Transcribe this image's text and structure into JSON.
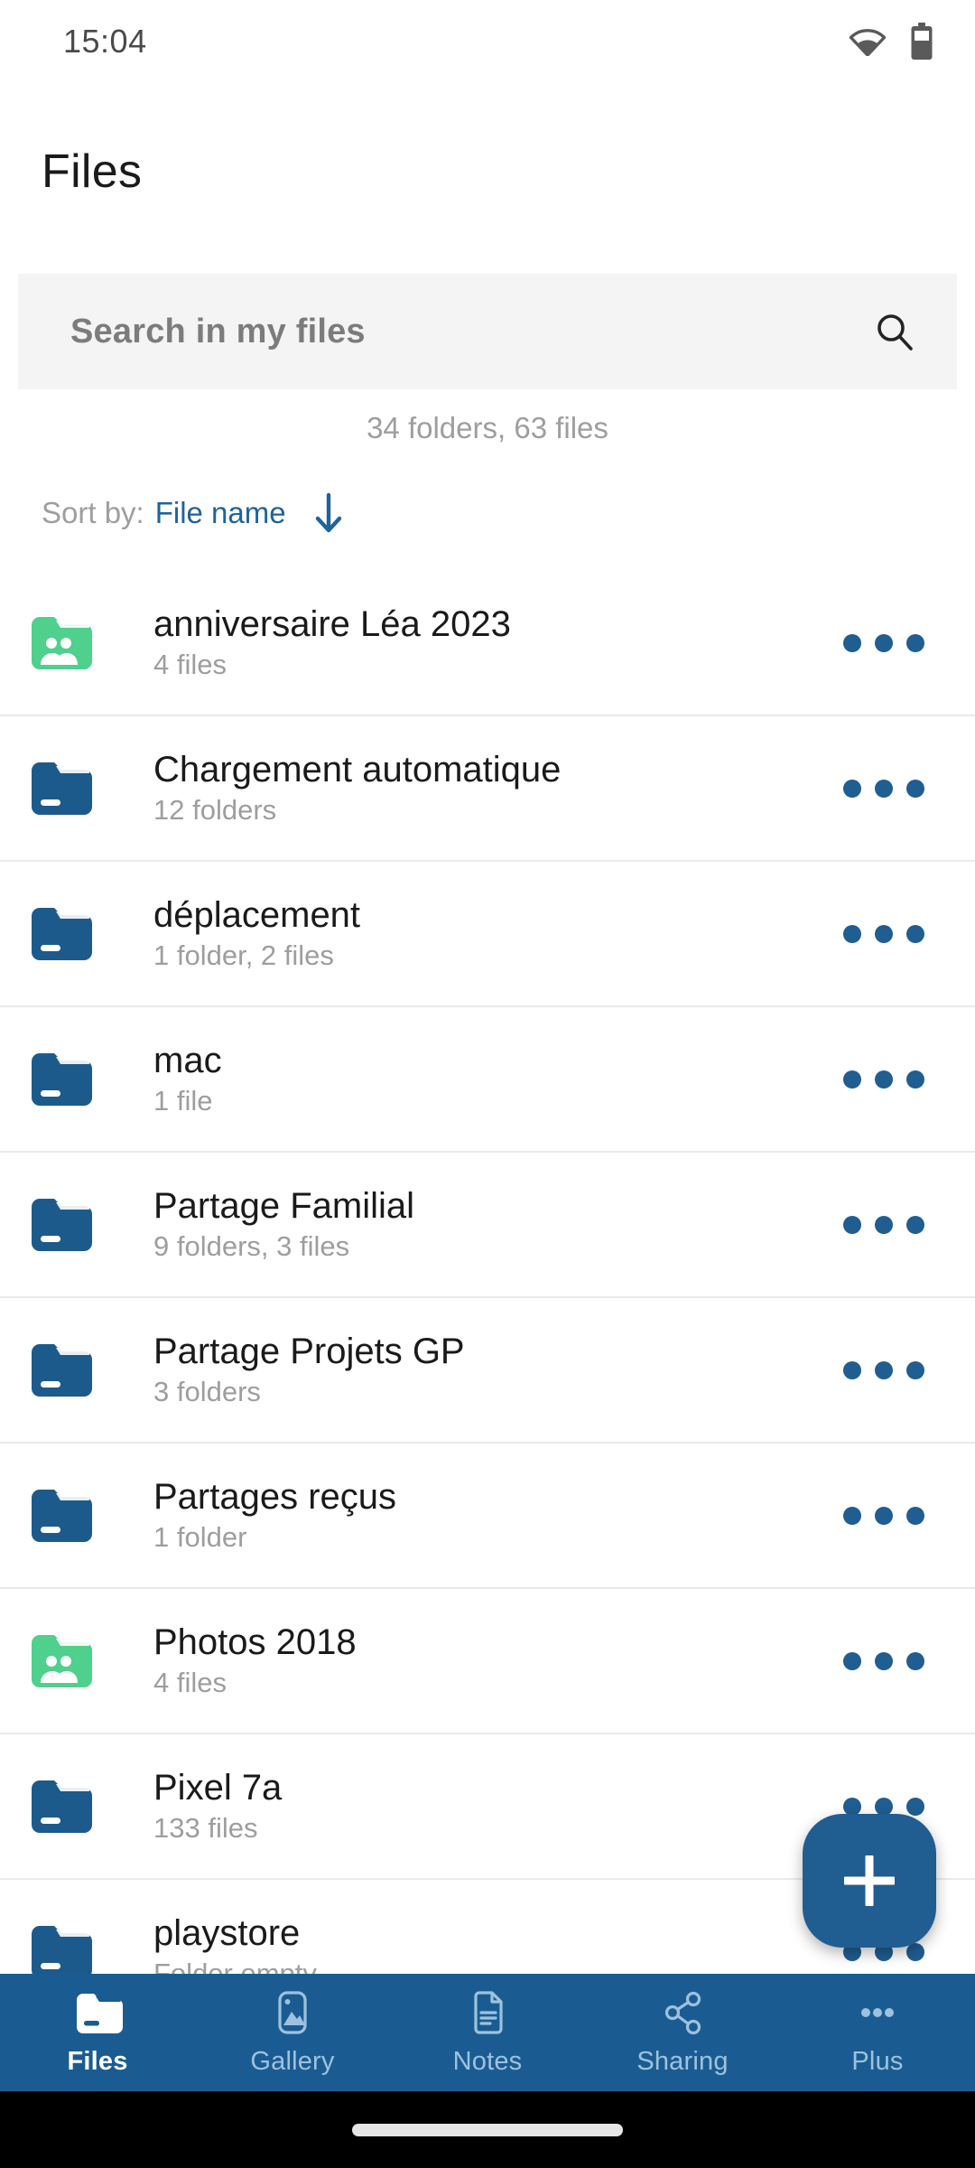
{
  "status_bar": {
    "time": "15:04",
    "wifi_icon": "wifi-icon",
    "battery_icon": "battery-icon"
  },
  "header": {
    "title": "Files"
  },
  "search": {
    "placeholder": "Search in my files",
    "value": "",
    "icon": "search-icon"
  },
  "summary": {
    "count_text": "34 folders, 63 files"
  },
  "sort": {
    "label": "Sort by:",
    "value": "File name",
    "direction_icon": "arrow-down-icon"
  },
  "colors": {
    "folder_blue": "#1d5a8c",
    "folder_green": "#4fd08c",
    "nav_blue": "#1a5c92",
    "accent_blue": "#205d91",
    "link_blue": "#1f639c",
    "muted_text": "#9e9e9e"
  },
  "files": {
    "overflow_menu_label": "...",
    "items": [
      {
        "name": "anniversaire Léa 2023",
        "detail": "4 files",
        "icon": "shared-folder-icon",
        "type": "shared"
      },
      {
        "name": "Chargement automatique",
        "detail": "12 folders",
        "icon": "folder-icon",
        "type": "folder"
      },
      {
        "name": "déplacement",
        "detail": "1 folder, 2 files",
        "icon": "folder-icon",
        "type": "folder"
      },
      {
        "name": "mac",
        "detail": "1 file",
        "icon": "folder-icon",
        "type": "folder"
      },
      {
        "name": "Partage Familial",
        "detail": "9 folders, 3 files",
        "icon": "folder-icon",
        "type": "folder"
      },
      {
        "name": "Partage Projets GP",
        "detail": "3 folders",
        "icon": "folder-icon",
        "type": "folder"
      },
      {
        "name": "Partages reçus",
        "detail": "1 folder",
        "icon": "folder-icon",
        "type": "folder"
      },
      {
        "name": "Photos 2018",
        "detail": "4 files",
        "icon": "shared-folder-icon",
        "type": "shared"
      },
      {
        "name": "Pixel 7a",
        "detail": "133 files",
        "icon": "folder-icon",
        "type": "folder"
      },
      {
        "name": "playstore",
        "detail": "Folder empty",
        "icon": "folder-icon",
        "type": "folder"
      }
    ]
  },
  "fab": {
    "label": "+",
    "icon": "plus-icon"
  },
  "bottom_nav": {
    "items": [
      {
        "label": "Files",
        "icon": "files-icon",
        "active": true
      },
      {
        "label": "Gallery",
        "icon": "gallery-icon",
        "active": false
      },
      {
        "label": "Notes",
        "icon": "notes-icon",
        "active": false
      },
      {
        "label": "Sharing",
        "icon": "sharing-icon",
        "active": false
      },
      {
        "label": "Plus",
        "icon": "more-icon",
        "active": false
      }
    ]
  }
}
